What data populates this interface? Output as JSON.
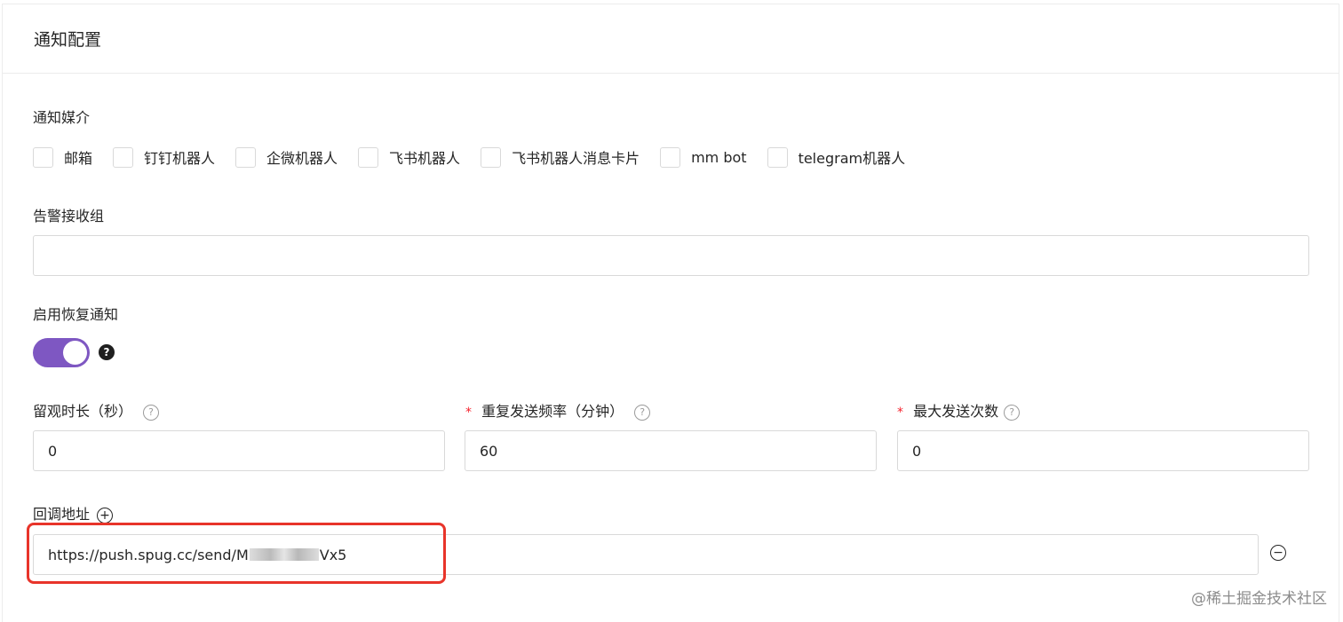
{
  "card": {
    "title": "通知配置"
  },
  "notify_media": {
    "label": "通知媒介",
    "options": [
      "邮箱",
      "钉钉机器人",
      "企微机器人",
      "飞书机器人",
      "飞书机器人消息卡片",
      "mm bot",
      "telegram机器人"
    ]
  },
  "alert_group": {
    "label": "告警接收组",
    "value": ""
  },
  "recovery": {
    "label": "启用恢复通知",
    "enabled": true,
    "help_icon": "question-circle-filled-icon"
  },
  "observe": {
    "label": "留观时长（秒）",
    "value": "0"
  },
  "repeat": {
    "label": "重复发送频率（分钟）",
    "value": "60"
  },
  "max_send": {
    "label": "最大发送次数",
    "value": "0"
  },
  "callback": {
    "label": "回调地址",
    "url_prefix": "https://push.spug.cc/send/M",
    "url_suffix": "Vx5",
    "add_icon": "plus-circle-icon",
    "remove_icon": "minus-circle-icon"
  },
  "watermark": "@稀土掘金技术社区",
  "colors": {
    "accent": "#7e57c2",
    "highlight": "#e8342a",
    "required": "#f5222d"
  }
}
